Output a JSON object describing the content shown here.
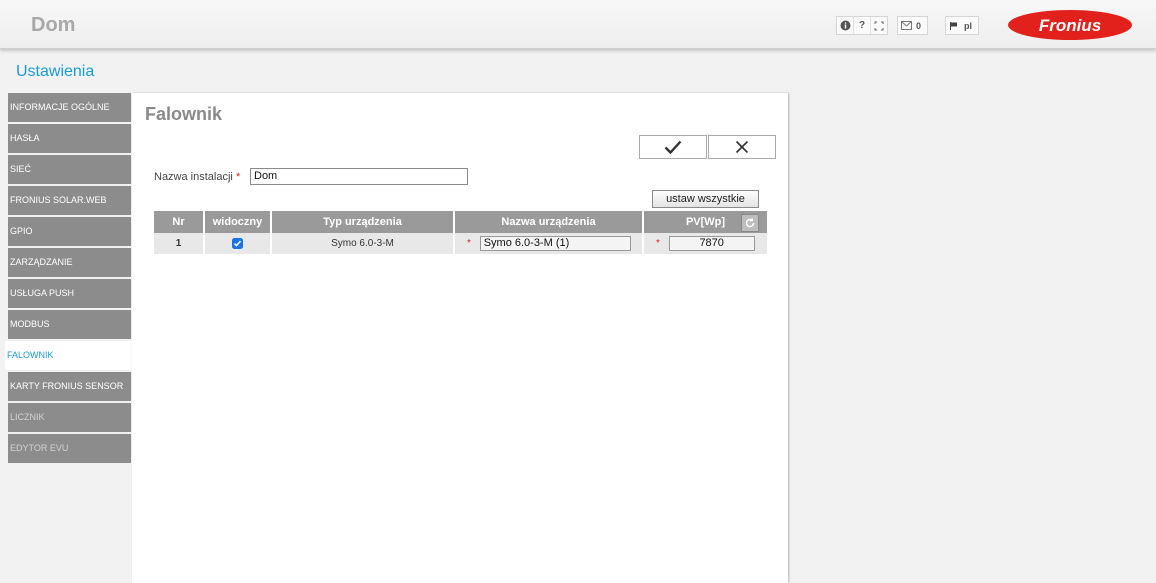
{
  "header": {
    "site_title": "Dom",
    "info_icon": "info-icon",
    "help_icon": "question-icon",
    "expand_icon": "expand-icon",
    "messages_icon": "envelope-icon",
    "messages_count": "0",
    "language_icon": "flag-icon",
    "language": "pl",
    "logo_text": "Fronius",
    "logo_color": "#e2211c"
  },
  "page": {
    "title": "Ustawienia"
  },
  "sidebar": {
    "items": [
      {
        "label": "INFORMACJE OGÓLNE"
      },
      {
        "label": "HASŁA"
      },
      {
        "label": "SIEĆ"
      },
      {
        "label": "FRONIUS SOLAR.WEB"
      },
      {
        "label": "GPIO"
      },
      {
        "label": "ZARZĄDZANIE"
      },
      {
        "label": "USŁUGA PUSH"
      },
      {
        "label": "MODBUS"
      },
      {
        "label": "FALOWNIK"
      },
      {
        "label": "KARTY FRONIUS SENSOR"
      },
      {
        "label": "LICZNIK"
      },
      {
        "label": "EDYTOR EVU"
      }
    ],
    "active": "FALOWNIK"
  },
  "panel": {
    "title": "Falownik",
    "confirm_icon": "checkmark-icon",
    "cancel_icon": "close-icon",
    "installation_label": "Nazwa instalacji",
    "required_mark": "*",
    "installation_value": "Dom",
    "set_all_label": "ustaw wszystkie",
    "refresh_icon": "refresh-icon"
  },
  "table": {
    "columns": [
      "Nr",
      "widoczny",
      "Typ urządzenia",
      "Nazwa urządzenia",
      "PV[Wp]"
    ],
    "rows": [
      {
        "nr": "1",
        "visible": true,
        "type": "Symo 6.0-3-M",
        "name": "Symo 6.0-3-M (1)",
        "pv": "7870"
      }
    ]
  },
  "colors": {
    "accent": "#1a9ad6",
    "nav_bg": "#8c8c8c",
    "required": "#e02020"
  }
}
